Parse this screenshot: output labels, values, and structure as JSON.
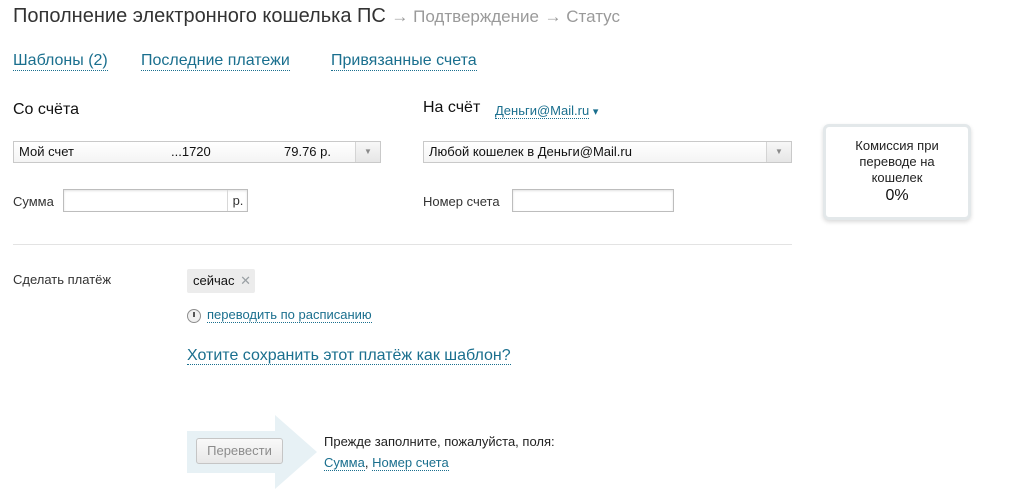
{
  "header": {
    "title": "Пополнение электронного кошелька ПС",
    "step_confirm": "→ Подтверждение",
    "step_status": "→ Статус"
  },
  "tabs": [
    {
      "label": "Шаблоны (2)"
    },
    {
      "label": "Последние платежи"
    },
    {
      "label": "Привязанные счета"
    }
  ],
  "from": {
    "heading": "Со счёта",
    "account_name": "Мой счет",
    "account_number": "...1720",
    "balance": "79.76 р."
  },
  "to": {
    "heading": "На счёт",
    "provider_link": "Деньги@Mail.ru",
    "provider_caret": "▾",
    "select_value": "Любой кошелек в Деньги@Mail.ru"
  },
  "amount": {
    "label": "Сумма",
    "value": "",
    "currency": "р."
  },
  "account_number_field": {
    "label": "Номер счета",
    "value": ""
  },
  "commission": {
    "text": "Комиссия при переводе на кошелек",
    "value": "0%"
  },
  "schedule": {
    "label": "Сделать платёж",
    "tag": "сейчас",
    "tag_remove": "✕",
    "schedule_link": "переводить по расписанию"
  },
  "template_link": "Хотите сохранить этот платёж как шаблон?",
  "submit": {
    "button": "Перевести",
    "hint": "Прежде заполните, пожалуйста, поля:",
    "field1": "Сумма",
    "separator": ",",
    "field2": "Номер счета"
  },
  "colors": {
    "link": "#1a6f8e",
    "muted": "#9a9a9a"
  }
}
